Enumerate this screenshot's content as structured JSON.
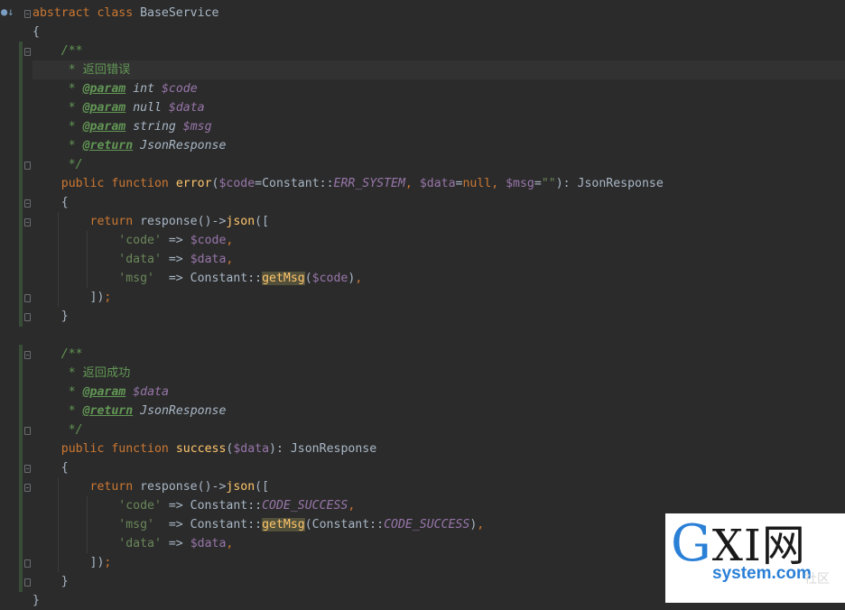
{
  "editor": {
    "lines": [
      [
        [
          "kw",
          "abstract class "
        ],
        [
          "plain",
          "BaseService"
        ]
      ],
      [
        [
          "plain",
          "{"
        ]
      ],
      [
        [
          "plain",
          "    "
        ],
        [
          "cm",
          "/**"
        ]
      ],
      [
        [
          "plain",
          "     "
        ],
        [
          "cm",
          "* "
        ],
        [
          "cm cjk",
          "返回错误"
        ]
      ],
      [
        [
          "plain",
          "     "
        ],
        [
          "cm",
          "* "
        ],
        [
          "tag",
          "@param"
        ],
        [
          "plain",
          " "
        ],
        [
          "ctype",
          "int"
        ],
        [
          "plain",
          " "
        ],
        [
          "cvar",
          "$code"
        ]
      ],
      [
        [
          "plain",
          "     "
        ],
        [
          "cm",
          "* "
        ],
        [
          "tag",
          "@param"
        ],
        [
          "plain",
          " "
        ],
        [
          "ctype",
          "null"
        ],
        [
          "plain",
          " "
        ],
        [
          "cvar",
          "$data"
        ]
      ],
      [
        [
          "plain",
          "     "
        ],
        [
          "cm",
          "* "
        ],
        [
          "tag",
          "@param"
        ],
        [
          "plain",
          " "
        ],
        [
          "ctype",
          "string"
        ],
        [
          "plain",
          " "
        ],
        [
          "cvar",
          "$msg"
        ]
      ],
      [
        [
          "plain",
          "     "
        ],
        [
          "cm",
          "* "
        ],
        [
          "tag",
          "@return"
        ],
        [
          "plain",
          " "
        ],
        [
          "ctype",
          "JsonResponse"
        ]
      ],
      [
        [
          "plain",
          "     "
        ],
        [
          "cm",
          "*/"
        ]
      ],
      [
        [
          "plain",
          "    "
        ],
        [
          "kw",
          "public function "
        ],
        [
          "fn",
          "error"
        ],
        [
          "plain",
          "("
        ],
        [
          "var",
          "$code"
        ],
        [
          "plain",
          "=Constant::"
        ],
        [
          "const",
          "ERR_SYSTEM"
        ],
        [
          "kw",
          ", "
        ],
        [
          "var",
          "$data"
        ],
        [
          "plain",
          "="
        ],
        [
          "kw",
          "null, "
        ],
        [
          "var",
          "$msg"
        ],
        [
          "plain",
          "="
        ],
        [
          "str",
          "\"\""
        ],
        [
          "plain",
          "): JsonResponse"
        ]
      ],
      [
        [
          "plain",
          "    {"
        ]
      ],
      [
        [
          "plain",
          "        "
        ],
        [
          "kw",
          "return "
        ],
        [
          "plain",
          "response()->"
        ],
        [
          "fn",
          "json"
        ],
        [
          "plain",
          "(["
        ]
      ],
      [
        [
          "plain",
          "            "
        ],
        [
          "str",
          "'code'"
        ],
        [
          "plain",
          " => "
        ],
        [
          "var",
          "$code"
        ],
        [
          "kw",
          ","
        ]
      ],
      [
        [
          "plain",
          "            "
        ],
        [
          "str",
          "'data'"
        ],
        [
          "plain",
          " => "
        ],
        [
          "var",
          "$data"
        ],
        [
          "kw",
          ","
        ]
      ],
      [
        [
          "plain",
          "            "
        ],
        [
          "str",
          "'msg'"
        ],
        [
          "plain",
          "  => Constant::"
        ],
        [
          "hl",
          "getMsg"
        ],
        [
          "plain",
          "("
        ],
        [
          "var",
          "$code"
        ],
        [
          "plain",
          ")"
        ],
        [
          "kw",
          ","
        ]
      ],
      [
        [
          "plain",
          "        ])"
        ],
        [
          "kw",
          ";"
        ]
      ],
      [
        [
          "plain",
          "    }"
        ]
      ],
      [],
      [
        [
          "plain",
          "    "
        ],
        [
          "cm",
          "/**"
        ]
      ],
      [
        [
          "plain",
          "     "
        ],
        [
          "cm",
          "* "
        ],
        [
          "cm cjk",
          "返回成功"
        ]
      ],
      [
        [
          "plain",
          "     "
        ],
        [
          "cm",
          "* "
        ],
        [
          "tag",
          "@param"
        ],
        [
          "plain",
          " "
        ],
        [
          "cvar",
          "$data"
        ]
      ],
      [
        [
          "plain",
          "     "
        ],
        [
          "cm",
          "* "
        ],
        [
          "tag",
          "@return"
        ],
        [
          "plain",
          " "
        ],
        [
          "ctype",
          "JsonResponse"
        ]
      ],
      [
        [
          "plain",
          "     "
        ],
        [
          "cm",
          "*/"
        ]
      ],
      [
        [
          "plain",
          "    "
        ],
        [
          "kw",
          "public function "
        ],
        [
          "fn",
          "success"
        ],
        [
          "plain",
          "("
        ],
        [
          "var",
          "$data"
        ],
        [
          "plain",
          "): JsonResponse"
        ]
      ],
      [
        [
          "plain",
          "    {"
        ]
      ],
      [
        [
          "plain",
          "        "
        ],
        [
          "kw",
          "return "
        ],
        [
          "plain",
          "response()->"
        ],
        [
          "fn",
          "json"
        ],
        [
          "plain",
          "(["
        ]
      ],
      [
        [
          "plain",
          "            "
        ],
        [
          "str",
          "'code'"
        ],
        [
          "plain",
          " => Constant::"
        ],
        [
          "const",
          "CODE_SUCCESS"
        ],
        [
          "kw",
          ","
        ]
      ],
      [
        [
          "plain",
          "            "
        ],
        [
          "str",
          "'msg'"
        ],
        [
          "plain",
          "  => Constant::"
        ],
        [
          "hl",
          "getMsg"
        ],
        [
          "plain",
          "(Constant::"
        ],
        [
          "const",
          "CODE_SUCCESS"
        ],
        [
          "plain",
          ")"
        ],
        [
          "kw",
          ","
        ]
      ],
      [
        [
          "plain",
          "            "
        ],
        [
          "str",
          "'data'"
        ],
        [
          "plain",
          " => "
        ],
        [
          "var",
          "$data"
        ],
        [
          "kw",
          ","
        ]
      ],
      [
        [
          "plain",
          "        ])"
        ],
        [
          "kw",
          ";"
        ]
      ],
      [
        [
          "plain",
          "    }"
        ]
      ],
      [
        [
          "plain",
          "}"
        ]
      ]
    ]
  },
  "watermark": {
    "logo_g": "G",
    "logo_rest": "XI网",
    "domain": "system.com",
    "faint": "社区"
  }
}
